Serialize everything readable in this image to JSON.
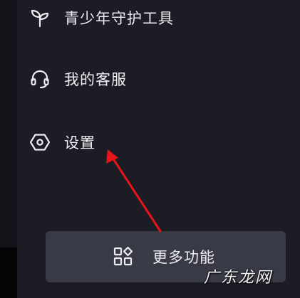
{
  "menu": {
    "items": [
      {
        "label": "青少年守护工具",
        "icon": "sprout-icon"
      },
      {
        "label": "我的客服",
        "icon": "headset-icon"
      },
      {
        "label": "设置",
        "icon": "hexagon-settings-icon"
      }
    ]
  },
  "more_button": {
    "label": "更多功能",
    "icon": "grid-apps-icon"
  },
  "watermark": {
    "text": "广东龙网"
  },
  "colors": {
    "annotation_arrow": "#e8141b",
    "button_bg": "#383a45",
    "text": "#eeeef2"
  }
}
